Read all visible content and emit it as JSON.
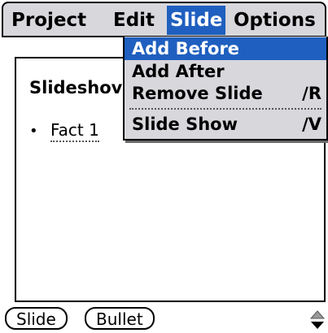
{
  "menubar": {
    "menus": [
      {
        "label": "Project"
      },
      {
        "label": "Edit"
      },
      {
        "label": "Slide"
      },
      {
        "label": "Options"
      }
    ],
    "active_menu": "Slide"
  },
  "slide_menu": {
    "items": [
      {
        "label": "Add Before",
        "shortcut": ""
      },
      {
        "label": "Add After",
        "shortcut": ""
      },
      {
        "label": "Remove Slide",
        "shortcut": "∕R"
      },
      {
        "label": "Slide Show",
        "shortcut": "∕V"
      }
    ],
    "highlighted_item": "Add Before"
  },
  "document": {
    "title": "Slideshov",
    "bullets": [
      {
        "text": "Fact 1"
      }
    ]
  },
  "bottom_bar": {
    "slide_button": "Slide",
    "bullet_button": "Bullet"
  },
  "colors": {
    "highlight": "#1f5fbf",
    "menu_background": "#d7d7dc"
  },
  "icons": {
    "bullet": "bullet-dot-icon",
    "scroll": "scroll-up-down-icon"
  }
}
